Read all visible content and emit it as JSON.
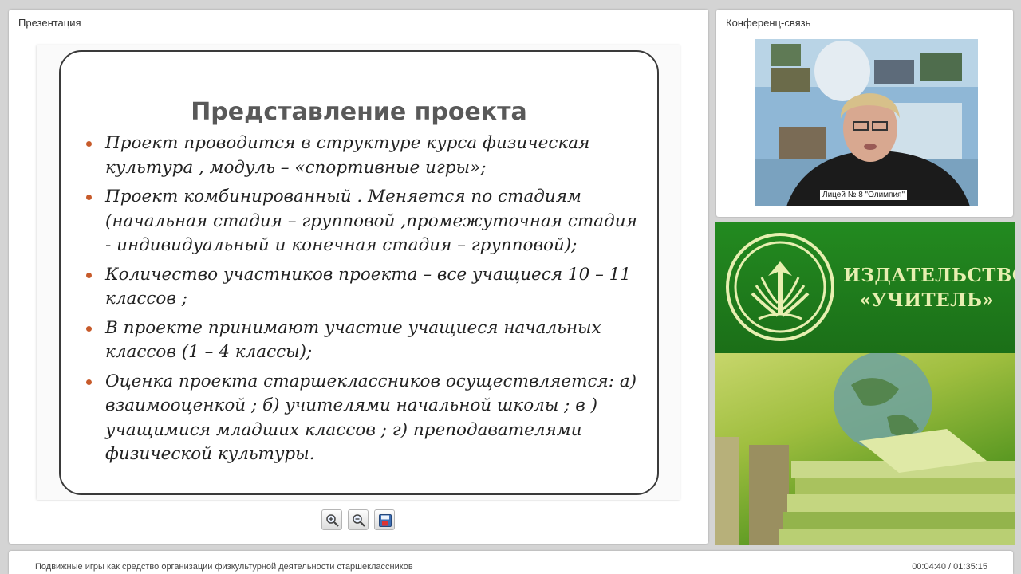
{
  "presentation_panel": {
    "title": "Презентация"
  },
  "conference_panel": {
    "title": "Конференц-связь",
    "caption": "Лицей № 8 \"Олимпия\""
  },
  "slide": {
    "title": "Представление проекта",
    "bullets": [
      "Проект проводится в структуре курса физическая культура , модуль – «спортивные игры»;",
      "Проект комбинированный . Меняется по стадиям (начальная стадия – групповой ,промежуточная стадия - индивидуальный  и конечная стадия – групповой);",
      "Количество участников  проекта – все учащиеся 10 – 11 классов ;",
      "В проекте  принимают участие учащиеся начальных классов (1 – 4 классы);",
      "Оценка проекта старшеклассников осуществляется: а) взаимооценкой ; б) учителями начальной школы ; в ) учащимися младших классов ; г) преподавателями физической культуры."
    ]
  },
  "toolbar": {
    "icons": [
      "zoom-in-icon",
      "zoom-out-icon",
      "save-icon"
    ]
  },
  "banner": {
    "line1": "ИЗДАТЕЛЬСТВО",
    "line2": "«УЧИТЕЛЬ»"
  },
  "footer": {
    "title": "Подвижные игры как средство организации физкультурной деятельности старшеклассников",
    "time": "00:04:40 / 01:35:15"
  },
  "colors": {
    "banner_green": "#1f7a1c",
    "bullet_dot": "#c75b2b",
    "banner_text": "#e7efb0"
  }
}
